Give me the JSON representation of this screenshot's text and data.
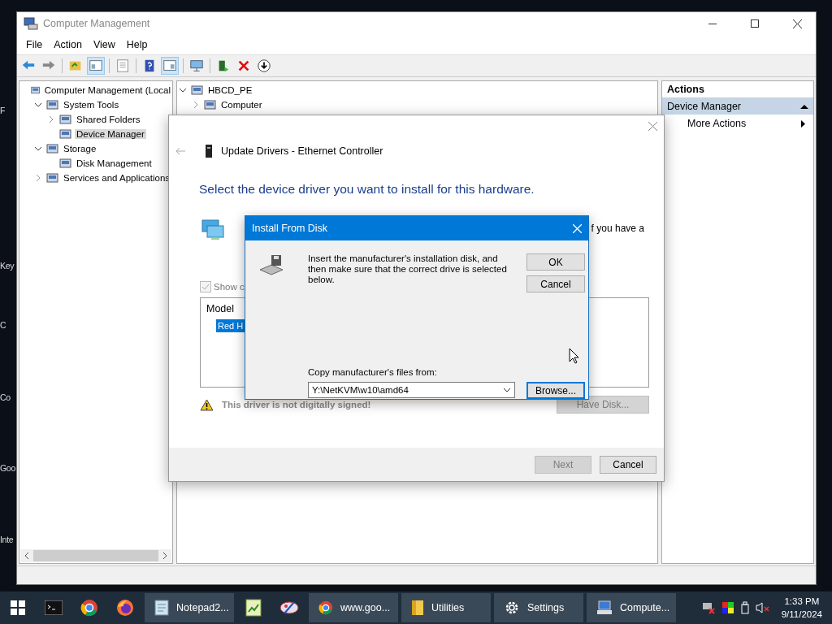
{
  "desktop_labels": [
    "F",
    "Key",
    "C",
    "Co",
    "Goo",
    "Inte"
  ],
  "main_window": {
    "title": "Computer Management",
    "menu": [
      "File",
      "Action",
      "View",
      "Help"
    ],
    "tree": [
      {
        "label": "Computer Management (Local",
        "selected": false,
        "children": [
          {
            "label": "System Tools",
            "expanded": true,
            "selected": false,
            "children": [
              {
                "label": "Shared Folders",
                "expanded": false,
                "selected": false
              },
              {
                "label": "Device Manager",
                "selected": true
              }
            ]
          },
          {
            "label": "Storage",
            "expanded": true,
            "selected": false,
            "children": [
              {
                "label": "Disk Management",
                "selected": false
              }
            ]
          },
          {
            "label": "Services and Applications",
            "expanded": false,
            "selected": false
          }
        ]
      }
    ],
    "center_tree": [
      {
        "label": "HBCD_PE",
        "expanded": true,
        "children": [
          {
            "label": "Computer",
            "expanded": false
          }
        ]
      }
    ],
    "actions": {
      "header": "Actions",
      "section": "Device Manager",
      "items": [
        "More Actions"
      ]
    }
  },
  "update_dialog": {
    "title": "Update Drivers - Ethernet Controller",
    "heading": "Select the device driver you want to install for this hardware.",
    "partial_text": "f you have a",
    "show_compatible": {
      "label": "Show c",
      "checked": true,
      "disabled": true
    },
    "list": {
      "header": "Model",
      "items": [
        {
          "label": "Red H",
          "selected": true
        }
      ]
    },
    "warning": "This driver is not digitally signed!",
    "have_disk": {
      "label": "Have Disk...",
      "disabled": true
    },
    "buttons": [
      {
        "label": "Next",
        "disabled": true
      },
      {
        "label": "Cancel",
        "disabled": false
      }
    ]
  },
  "install_dialog": {
    "title": "Install From Disk",
    "message": "Insert the manufacturer's installation disk, and then make sure that the correct drive is selected below.",
    "buttons": [
      "OK",
      "Cancel"
    ],
    "copy_label": "Copy manufacturer's files from:",
    "path": "Y:\\NetKVM\\w10\\amd64",
    "browse": "Browse..."
  },
  "taskbar": {
    "apps": [
      {
        "kind": "pinned"
      },
      {
        "kind": "pinned"
      },
      {
        "kind": "pinned"
      },
      {
        "kind": "window",
        "label": "Notepad2..."
      },
      {
        "kind": "pinned"
      },
      {
        "kind": "pinned"
      },
      {
        "kind": "window",
        "label": "www.goo..."
      },
      {
        "kind": "window",
        "label": "Utilities"
      },
      {
        "kind": "window",
        "label": "Settings"
      },
      {
        "kind": "window",
        "label": "Compute..."
      }
    ],
    "time": "1:33 PM",
    "date": "9/11/2024"
  }
}
